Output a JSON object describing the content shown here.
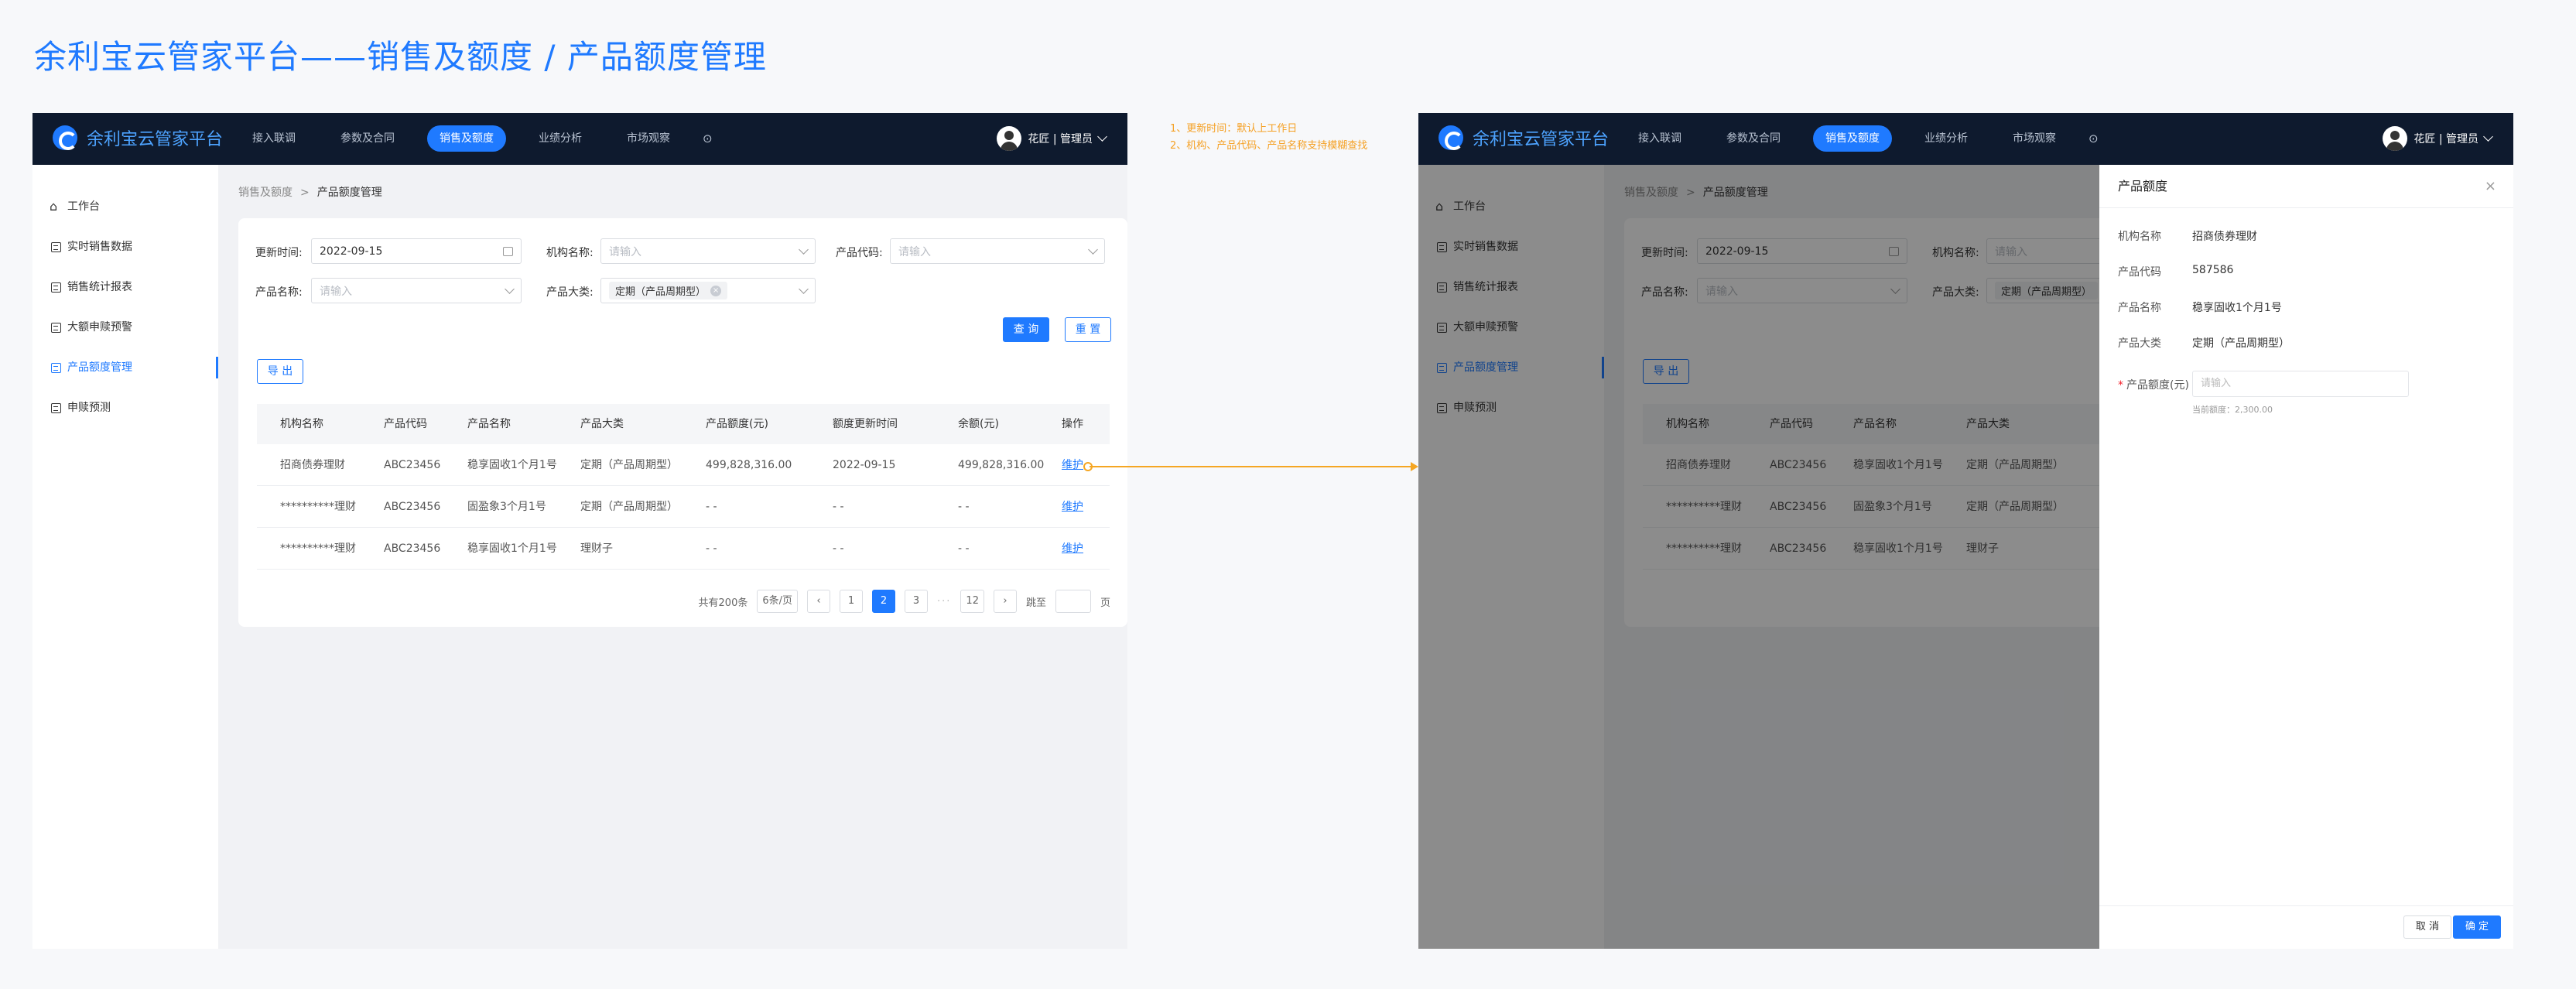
{
  "page_title": "余利宝云管家平台——销售及额度 / 产品额度管理",
  "annotations": {
    "note1": "1、更新时间：默认上工作日",
    "note2": "2、机构、产品代码、产品名称支持模糊查找"
  },
  "app": {
    "brand": "余利宝云管家平台",
    "nav": [
      "接入联调",
      "参数及合同",
      "销售及额度",
      "业绩分析",
      "市场观察"
    ],
    "active_nav": "销售及额度",
    "user": "花匠 | 管理员",
    "sidebar": [
      "工作台",
      "实时销售数据",
      "销售统计报表",
      "大额申赎预警",
      "产品额度管理",
      "申赎预测"
    ],
    "active_sidebar": "产品额度管理",
    "breadcrumb": {
      "parent": "销售及额度",
      "current": "产品额度管理"
    }
  },
  "filters": {
    "update_time_label": "更新时间:",
    "update_time_value": "2022-09-15",
    "org_label": "机构名称:",
    "org_placeholder": "请输入",
    "code_label": "产品代码:",
    "code_placeholder": "请输入",
    "name_label": "产品名称:",
    "name_placeholder": "请输入",
    "category_label": "产品大类:",
    "category_value": "定期（产品周期型）",
    "query": "查 询",
    "reset": "重 置",
    "export": "导 出"
  },
  "table": {
    "headers": [
      "机构名称",
      "产品代码",
      "产品名称",
      "产品大类",
      "产品额度(元)",
      "额度更新时间",
      "余额(元)",
      "操作"
    ],
    "rows": [
      [
        "招商债券理财",
        "ABC23456",
        "稳享固收1个月1号",
        "定期（产品周期型）",
        "499,828,316.00",
        "2022-09-15",
        "499,828,316.00",
        "维护"
      ],
      [
        "**********理财",
        "ABC23456",
        "固盈象3个月1号",
        "定期（产品周期型）",
        "- -",
        "- -",
        "- -",
        "维护"
      ],
      [
        "**********理财",
        "ABC23456",
        "稳享固收1个月1号",
        "理财子",
        "- -",
        "- -",
        "- -",
        "维护"
      ]
    ]
  },
  "pagination": {
    "total": "共有200条",
    "page_size": "6条/页",
    "pages": [
      "1",
      "2",
      "3"
    ],
    "current": "2",
    "dots": "···",
    "last": "12",
    "goto": "跳至",
    "page_unit": "页"
  },
  "drawer": {
    "title": "产品额度",
    "fields": [
      {
        "label": "机构名称",
        "value": "招商债券理财"
      },
      {
        "label": "产品代码",
        "value": "587586"
      },
      {
        "label": "产品名称",
        "value": "稳享固收1个月1号"
      },
      {
        "label": "产品大类",
        "value": "定期（产品周期型）"
      }
    ],
    "quota_label": "产品额度(元)",
    "quota_placeholder": "请输入",
    "hint": "当前额度：2,300.00",
    "cancel": "取 消",
    "ok": "确 定"
  },
  "colors": {
    "accent": "#1f7aff",
    "topbar": "#0e1a2e",
    "note": "#f5a023"
  }
}
